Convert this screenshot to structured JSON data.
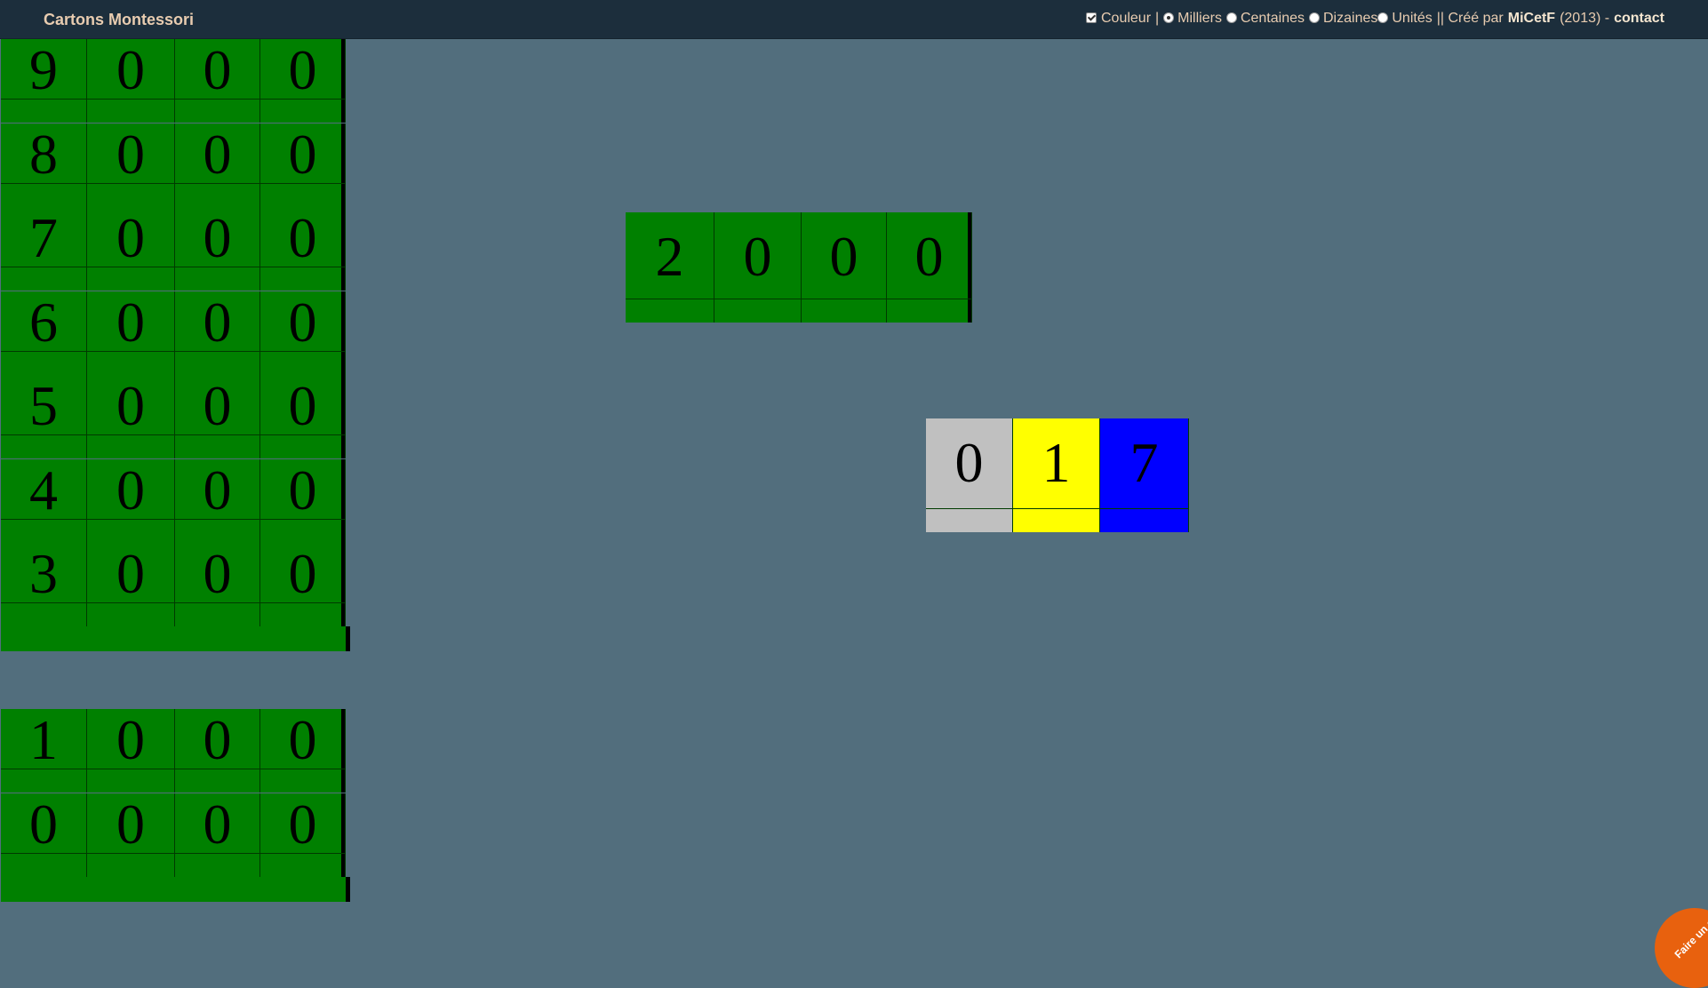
{
  "app": {
    "title": "Cartons Montessori"
  },
  "options": {
    "couleur_label": "Couleur",
    "sep1": "|",
    "milliers_label": "Milliers",
    "centaines_label": "Centaines",
    "dizaines_label": "Dizaines",
    "unites_label": "Unités",
    "credit_prefix": "|| Créé par",
    "author": "MiCetF",
    "year": "(2013) -",
    "contact": "contact",
    "selected_mode": "Milliers",
    "couleur_checked": true
  },
  "stack": {
    "cards": [
      {
        "digits": [
          "9",
          "0",
          "0",
          "0"
        ]
      },
      {
        "digits": [
          "8",
          "0",
          "0",
          "0"
        ]
      },
      {
        "digits": [
          "7",
          "0",
          "0",
          "0"
        ]
      },
      {
        "digits": [
          "6",
          "0",
          "0",
          "0"
        ]
      },
      {
        "digits": [
          "5",
          "0",
          "0",
          "0"
        ]
      },
      {
        "digits": [
          "4",
          "0",
          "0",
          "0"
        ]
      },
      {
        "digits": [
          "3",
          "0",
          "0",
          "0"
        ]
      }
    ],
    "bottom_cards": [
      {
        "digits": [
          "1",
          "0",
          "0",
          "0"
        ]
      },
      {
        "digits": [
          "0",
          "0",
          "0",
          "0"
        ]
      }
    ]
  },
  "placed": {
    "thousands": {
      "digits": [
        "2",
        "0",
        "0",
        "0"
      ]
    },
    "small": {
      "digits": [
        "0",
        "1",
        "7"
      ]
    }
  },
  "colors": {
    "thousands": "#008000",
    "hundreds": "#c0c0c0",
    "tens": "#ffff00",
    "units": "#0000ff",
    "background": "#526e7d",
    "topbar": "#1c2e3c"
  },
  "donate": {
    "label": "Faire un don"
  }
}
